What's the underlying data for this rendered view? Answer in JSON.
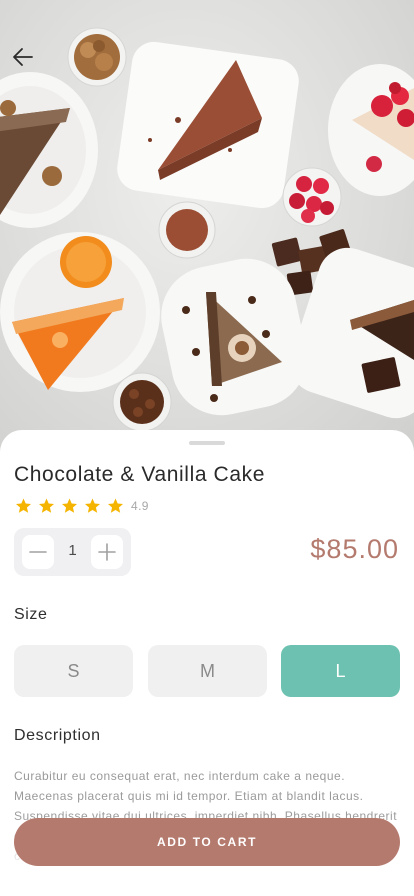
{
  "product": {
    "name": "Chocolate & Vanilla Cake",
    "rating": 4.9,
    "rating_label": "4.9",
    "stars_filled": 5,
    "price": "$85.00"
  },
  "quantity": {
    "value": "1"
  },
  "size": {
    "label": "Size",
    "options": [
      "S",
      "M",
      "L"
    ],
    "selected": "L"
  },
  "description": {
    "label": "Description",
    "text": "Curabitur eu consequat erat, nec interdum cake a neque. Maecenas placerat quis mi id tempor. Etiam at blandit lacus. Suspendisse vitae dui ultrices, imperdiet nibh. Phasellus hendrerit consectetur bibendum. Morbi facilisis mauris mattis iaculis consectetur."
  },
  "actions": {
    "add_to_cart": "ADD TO CART"
  },
  "colors": {
    "accent_brown": "#b57a6e",
    "accent_teal": "#6cc1b0",
    "star": "#f5b400"
  },
  "icons": {
    "back": "arrow-left-icon",
    "minus": "minus-icon",
    "plus": "plus-icon",
    "star": "star-icon"
  }
}
